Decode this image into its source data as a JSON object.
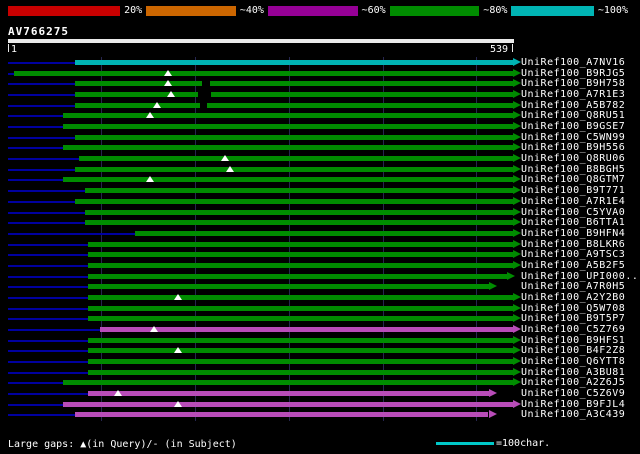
{
  "chart_data": {
    "type": "bar",
    "title": "BLAST-style alignment overview of query AV766275 against UniRef100 hits",
    "query": {
      "name": "AV766275",
      "start_label": "1",
      "end_label": "539",
      "length": 539
    },
    "xlim": [
      1,
      539
    ],
    "gridline_positions": [
      100,
      200,
      300,
      400,
      500
    ],
    "identity_scale": {
      "labels": [
        "20%",
        "~40%",
        "~60%",
        "~80%",
        "~100%"
      ],
      "colors": [
        "#c80000",
        "#cc6600",
        "#960096",
        "#008c00",
        "#00b4b4"
      ]
    },
    "bar_colors": {
      "cyan": "#00b4b4",
      "green": "#008c00",
      "magenta": "#b84cb8"
    },
    "hits": [
      {
        "id": "UniRef100_A7NV16",
        "color": "cyan",
        "qstart": 72,
        "qend": 539,
        "query_gaps": [],
        "subject_gaps": []
      },
      {
        "id": "UniRef100_B9RJG5",
        "color": "green",
        "qstart": 7,
        "qend": 539,
        "query_gaps": [
          171
        ],
        "subject_gaps": []
      },
      {
        "id": "UniRef100_B9H758",
        "color": "green",
        "qstart": 72,
        "qend": 539,
        "query_gaps": [
          171
        ],
        "subject_gaps": [
          {
            "pos": 208,
            "width": 8
          }
        ]
      },
      {
        "id": "UniRef100_A7R1E3",
        "color": "green",
        "qstart": 72,
        "qend": 539,
        "query_gaps": [
          175
        ],
        "subject_gaps": [
          {
            "pos": 203,
            "width": 14
          }
        ]
      },
      {
        "id": "UniRef100_A5B782",
        "color": "green",
        "qstart": 72,
        "qend": 539,
        "query_gaps": [
          160
        ],
        "subject_gaps": [
          {
            "pos": 205,
            "width": 8
          }
        ]
      },
      {
        "id": "UniRef100_Q8RU51",
        "color": "green",
        "qstart": 60,
        "qend": 539,
        "query_gaps": [
          152
        ],
        "subject_gaps": []
      },
      {
        "id": "UniRef100_B9GSE7",
        "color": "green",
        "qstart": 60,
        "qend": 539,
        "query_gaps": [],
        "subject_gaps": []
      },
      {
        "id": "UniRef100_C5WN99",
        "color": "green",
        "qstart": 72,
        "qend": 539,
        "query_gaps": [],
        "subject_gaps": []
      },
      {
        "id": "UniRef100_B9H556",
        "color": "green",
        "qstart": 60,
        "qend": 539,
        "query_gaps": [],
        "subject_gaps": []
      },
      {
        "id": "UniRef100_Q8RU06",
        "color": "green",
        "qstart": 77,
        "qend": 539,
        "query_gaps": [
          232
        ],
        "subject_gaps": []
      },
      {
        "id": "UniRef100_B8BGH5",
        "color": "green",
        "qstart": 72,
        "qend": 539,
        "query_gaps": [
          237
        ],
        "subject_gaps": []
      },
      {
        "id": "UniRef100_Q8GTM7",
        "color": "green",
        "qstart": 60,
        "qend": 539,
        "query_gaps": [
          152
        ],
        "subject_gaps": []
      },
      {
        "id": "UniRef100_B9T771",
        "color": "green",
        "qstart": 83,
        "qend": 539,
        "query_gaps": [],
        "subject_gaps": []
      },
      {
        "id": "UniRef100_A7R1E4",
        "color": "green",
        "qstart": 72,
        "qend": 539,
        "query_gaps": [],
        "subject_gaps": []
      },
      {
        "id": "UniRef100_C5YVA0",
        "color": "green",
        "qstart": 83,
        "qend": 539,
        "query_gaps": [],
        "subject_gaps": []
      },
      {
        "id": "UniRef100_B6TTA1",
        "color": "green",
        "qstart": 83,
        "qend": 539,
        "query_gaps": [],
        "subject_gaps": []
      },
      {
        "id": "UniRef100_B9HFN4",
        "color": "green",
        "qstart": 136,
        "qend": 539,
        "query_gaps": [],
        "subject_gaps": []
      },
      {
        "id": "UniRef100_B8LKR6",
        "color": "green",
        "qstart": 86,
        "qend": 539,
        "query_gaps": [],
        "subject_gaps": []
      },
      {
        "id": "UniRef100_A9TSC3",
        "color": "green",
        "qstart": 86,
        "qend": 539,
        "query_gaps": [],
        "subject_gaps": []
      },
      {
        "id": "UniRef100_A5B2F5",
        "color": "green",
        "qstart": 86,
        "qend": 539,
        "query_gaps": [],
        "subject_gaps": []
      },
      {
        "id": "UniRef100_UPI000...",
        "color": "green",
        "qstart": 86,
        "qend": 533,
        "query_gaps": [],
        "subject_gaps": []
      },
      {
        "id": "UniRef100_A7R0H5",
        "color": "green",
        "qstart": 86,
        "qend": 513,
        "query_gaps": [],
        "subject_gaps": []
      },
      {
        "id": "UniRef100_A2Y2B0",
        "color": "green",
        "qstart": 86,
        "qend": 539,
        "query_gaps": [
          182
        ],
        "subject_gaps": []
      },
      {
        "id": "UniRef100_Q5W708",
        "color": "green",
        "qstart": 86,
        "qend": 539,
        "query_gaps": [],
        "subject_gaps": []
      },
      {
        "id": "UniRef100_B9T5P7",
        "color": "green",
        "qstart": 86,
        "qend": 539,
        "query_gaps": [],
        "subject_gaps": []
      },
      {
        "id": "UniRef100_C5Z769",
        "color": "magenta",
        "qstart": 99,
        "qend": 539,
        "query_gaps": [
          157
        ],
        "subject_gaps": []
      },
      {
        "id": "UniRef100_B9HFS1",
        "color": "green",
        "qstart": 86,
        "qend": 539,
        "query_gaps": [],
        "subject_gaps": []
      },
      {
        "id": "UniRef100_B4F2Z8",
        "color": "green",
        "qstart": 86,
        "qend": 539,
        "query_gaps": [
          182
        ],
        "subject_gaps": []
      },
      {
        "id": "UniRef100_Q6YTT8",
        "color": "green",
        "qstart": 86,
        "qend": 539,
        "query_gaps": [],
        "subject_gaps": []
      },
      {
        "id": "UniRef100_A3BU81",
        "color": "green",
        "qstart": 86,
        "qend": 539,
        "query_gaps": [],
        "subject_gaps": []
      },
      {
        "id": "UniRef100_A2Z6J5",
        "color": "green",
        "qstart": 60,
        "qend": 539,
        "query_gaps": [],
        "subject_gaps": []
      },
      {
        "id": "UniRef100_C5Z6V9",
        "color": "magenta",
        "qstart": 86,
        "qend": 513,
        "query_gaps": [
          118
        ],
        "subject_gaps": []
      },
      {
        "id": "UniRef100_B9FJL4",
        "color": "magenta",
        "qstart": 60,
        "qend": 539,
        "query_gaps": [
          182
        ],
        "subject_gaps": []
      },
      {
        "id": "UniRef100_A3C439",
        "color": "magenta",
        "qstart": 72,
        "qend": 513,
        "query_gaps": [],
        "subject_gaps": []
      }
    ],
    "legend": {
      "large_gaps": "Large gaps: ▲(in Query)/- (in Subject)",
      "scale_line": "=100char."
    }
  }
}
